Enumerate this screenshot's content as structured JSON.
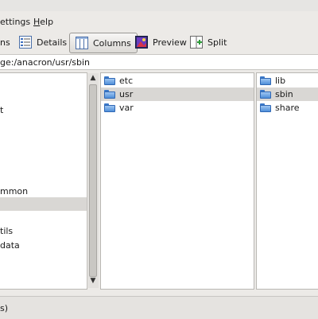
{
  "menubar": {
    "settings": "ettings",
    "help_prefix": "",
    "help_hot": "H",
    "help_rest": "elp"
  },
  "toolbar": {
    "icons_partial": "ns",
    "details": "Details",
    "columns": "Columns",
    "preview": "Preview",
    "split": "Split"
  },
  "location": {
    "path": "ge:/anacron/usr/sbin"
  },
  "column1": {
    "items": [
      {
        "label": "t",
        "selected": false
      },
      {
        "label": "mmon",
        "selected": false
      },
      {
        "label": "",
        "selected": true
      },
      {
        "label": "tils",
        "selected": false
      },
      {
        "label": "data",
        "selected": false
      }
    ]
  },
  "column2": {
    "items": [
      {
        "label": "etc",
        "selected": false
      },
      {
        "label": "usr",
        "selected": true
      },
      {
        "label": "var",
        "selected": false
      }
    ]
  },
  "column3": {
    "items": [
      {
        "label": "lib",
        "selected": false
      },
      {
        "label": "sbin",
        "selected": true
      },
      {
        "label": "share",
        "selected": false
      }
    ]
  },
  "status": {
    "text": "s)"
  },
  "colors": {
    "folder": "#4f8fd9",
    "selection": "#d9d7d4"
  },
  "icons": {
    "details": "details-view-icon",
    "columns": "columns-view-icon",
    "preview": "preview-icon",
    "split": "split-icon",
    "folder": "folder-icon"
  }
}
